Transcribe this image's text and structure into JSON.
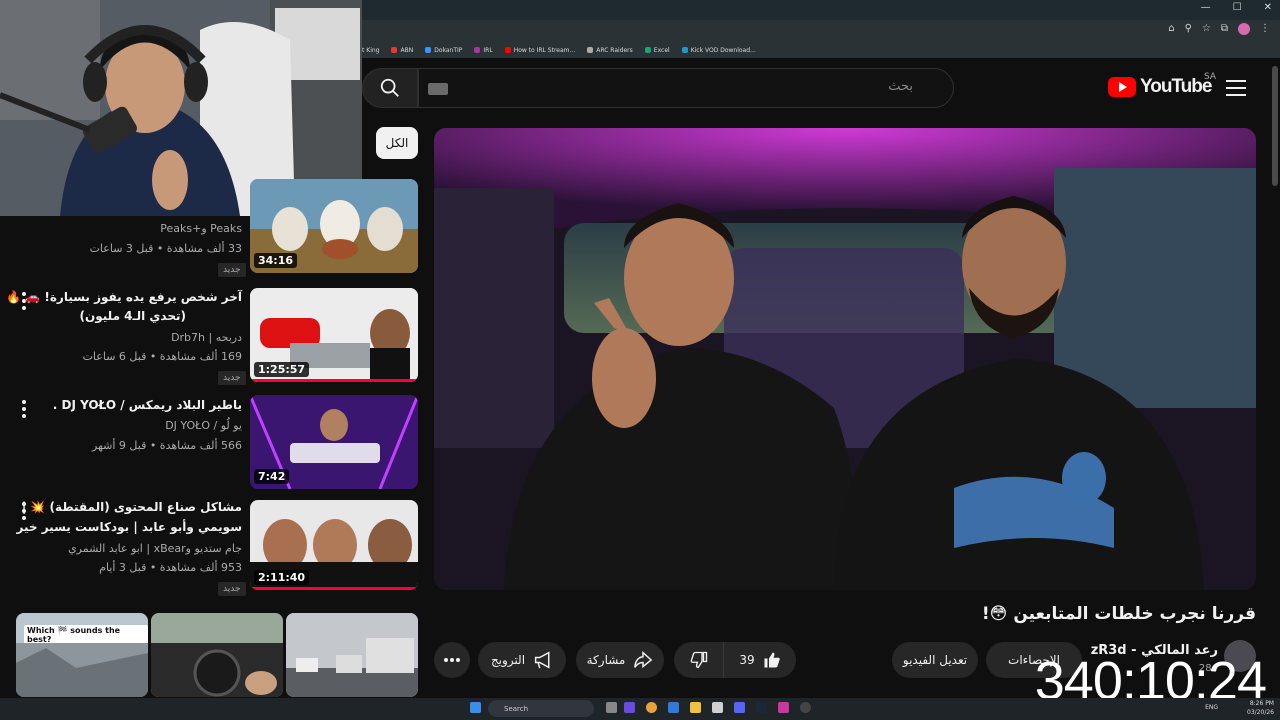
{
  "browser": {
    "window_controls": [
      "—",
      "☐",
      "✕"
    ],
    "bookmarks": [
      "t King",
      "ABN",
      "DokanTIP",
      "IRL",
      "How to IRL Stream...",
      "ARC Raiders",
      "Excel",
      "Kick VOD Download..."
    ]
  },
  "header": {
    "search_placeholder": "بحث",
    "logo_text": "YouTube",
    "region": "SA"
  },
  "chips": {
    "all": "الكل"
  },
  "sidebar": {
    "items": [
      {
        "title": "",
        "channel": "Peaks و+Peaks",
        "meta": "33 ألف مشاهدة • قبل 3 ساعات",
        "badge": "جديد",
        "duration": "34:16"
      },
      {
        "title_line1": "آخر شخص يرفع يده يفوز بسيارة! 🚗 🔥",
        "title_line2": "(تحدي الـ4 مليون)",
        "channel": "دربحه | Drb7h",
        "meta": "169 ألف مشاهدة • قبل 6 ساعات",
        "badge": "جديد",
        "duration": "1:25:57"
      },
      {
        "title": "ياطير البلاد ريمكس / DJ YOŁO .",
        "channel": "يو لُو / DJ YOŁO",
        "meta": "566 ألف مشاهدة • قبل 9 أشهر",
        "duration": "7:42"
      },
      {
        "title_line1": "مشاكل صناع المحتوى (المقتطة) 💥 |",
        "title_line2": "سويمي وأبو عابد | بودكاست يسير خير",
        "channel": "جام ستديو وxBear | ابو عابد الشمري",
        "meta": "953 ألف مشاهدة • قبل 3 أيام",
        "badge": "جديد",
        "duration": "2:11:40"
      }
    ],
    "shorts_caption": "Which 🏁 sounds the best?"
  },
  "video": {
    "title": "قررنا نجرب خلطات المتابعين 😳!",
    "channel": "رعد المالكي - zR3d",
    "subs": "284",
    "likes": "39",
    "share_label": "مشاركة",
    "promote_label": "الترويج",
    "edit_label": "تعديل الفيديو",
    "analytics_label": "الإحصاءات"
  },
  "overlay": {
    "timer": "340:10:24"
  },
  "taskbar": {
    "search": "Search",
    "lang": "ENG",
    "time": "8:26 PM",
    "date": "03/20/26"
  },
  "colors": {
    "accent": "#ff0000",
    "bg": "#0f0f0f",
    "progress": "#ff0033"
  }
}
